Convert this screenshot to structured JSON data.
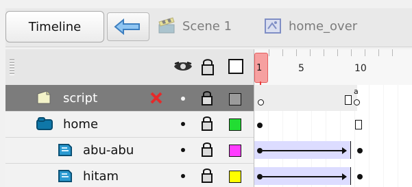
{
  "toolbar": {
    "timeline_label": "Timeline",
    "breadcrumbs": [
      {
        "label": "Scene 1",
        "icon": "clapperboard-icon"
      },
      {
        "label": "home_over",
        "icon": "symbol-icon"
      }
    ]
  },
  "ruler": {
    "playhead_frame": "1",
    "labels": [
      "5",
      "10"
    ]
  },
  "layers": [
    {
      "name": "script",
      "selected": true
    },
    {
      "name": "home",
      "selected": false
    },
    {
      "name": "abu-abu",
      "selected": false
    },
    {
      "name": "hitam",
      "selected": false
    }
  ],
  "timeline": {
    "frame_label": "a"
  },
  "colors": {
    "accent": "#f6a0a0",
    "selection": "#7c7c7c",
    "layer_colors": [
      "#9b9b9b",
      "#22dd33",
      "#ff3cff",
      "#ffff00"
    ]
  }
}
